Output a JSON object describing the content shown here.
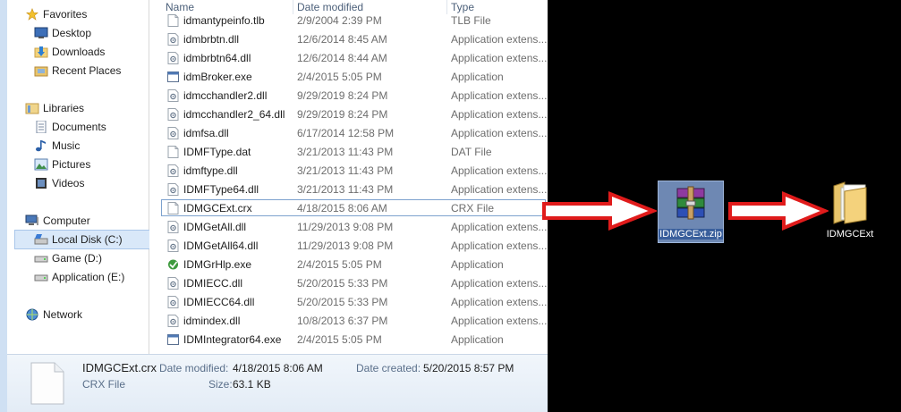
{
  "nav": {
    "favorites": "Favorites",
    "desktop": "Desktop",
    "downloads": "Downloads",
    "recent_places": "Recent Places",
    "libraries": "Libraries",
    "documents": "Documents",
    "music": "Music",
    "pictures": "Pictures",
    "videos": "Videos",
    "computer": "Computer",
    "local_disk": "Local Disk (C:)",
    "game": "Game (D:)",
    "application": "Application (E:)",
    "network": "Network"
  },
  "columns": {
    "name": "Name",
    "date": "Date modified",
    "type": "Type"
  },
  "files": [
    {
      "name": "idmantypeinfo.tlb",
      "date": "2/9/2004 2:39 PM",
      "type": "TLB File",
      "icon": "file-icon"
    },
    {
      "name": "idmbrbtn.dll",
      "date": "12/6/2014 8:45 AM",
      "type": "Application extens...",
      "icon": "dll-icon"
    },
    {
      "name": "idmbrbtn64.dll",
      "date": "12/6/2014 8:44 AM",
      "type": "Application extens...",
      "icon": "dll-icon"
    },
    {
      "name": "idmBroker.exe",
      "date": "2/4/2015 5:05 PM",
      "type": "Application",
      "icon": "exe-icon"
    },
    {
      "name": "idmcchandler2.dll",
      "date": "9/29/2019 8:24 PM",
      "type": "Application extens...",
      "icon": "dll-icon"
    },
    {
      "name": "idmcchandler2_64.dll",
      "date": "9/29/2019 8:24 PM",
      "type": "Application extens...",
      "icon": "dll-icon"
    },
    {
      "name": "idmfsa.dll",
      "date": "6/17/2014 12:58 PM",
      "type": "Application extens...",
      "icon": "dll-icon"
    },
    {
      "name": "IDMFType.dat",
      "date": "3/21/2013 11:43 PM",
      "type": "DAT File",
      "icon": "file-icon"
    },
    {
      "name": "idmftype.dll",
      "date": "3/21/2013 11:43 PM",
      "type": "Application extens...",
      "icon": "dll-icon"
    },
    {
      "name": "IDMFType64.dll",
      "date": "3/21/2013 11:43 PM",
      "type": "Application extens...",
      "icon": "dll-icon"
    },
    {
      "name": "IDMGCExt.crx",
      "date": "4/18/2015 8:06 AM",
      "type": "CRX File",
      "icon": "file-icon",
      "selected": true
    },
    {
      "name": "IDMGetAll.dll",
      "date": "11/29/2013 9:08 PM",
      "type": "Application extens...",
      "icon": "dll-icon"
    },
    {
      "name": "IDMGetAll64.dll",
      "date": "11/29/2013 9:08 PM",
      "type": "Application extens...",
      "icon": "dll-icon"
    },
    {
      "name": "IDMGrHlp.exe",
      "date": "2/4/2015 5:05 PM",
      "type": "Application",
      "icon": "idm-exe-icon"
    },
    {
      "name": "IDMIECC.dll",
      "date": "5/20/2015 5:33 PM",
      "type": "Application extens...",
      "icon": "dll-icon"
    },
    {
      "name": "IDMIECC64.dll",
      "date": "5/20/2015 5:33 PM",
      "type": "Application extens...",
      "icon": "dll-icon"
    },
    {
      "name": "idmindex.dll",
      "date": "10/8/2013 6:37 PM",
      "type": "Application extens...",
      "icon": "dll-icon"
    },
    {
      "name": "IDMIntegrator64.exe",
      "date": "2/4/2015 5:05 PM",
      "type": "Application",
      "icon": "exe-icon"
    }
  ],
  "details": {
    "filename": "IDMGCExt.crx",
    "filetype": "CRX File",
    "modified_label": "Date modified:",
    "modified_value": "4/18/2015 8:06 AM",
    "created_label": "Date created:",
    "created_value": "5/20/2015 8:57 PM",
    "size_label": "Size:",
    "size_value": "63.1 KB"
  },
  "desktop": {
    "zip_label": "IDMGCExt.zip",
    "folder_label": "IDMGCExt"
  },
  "colors": {
    "arrow_fill": "#ffffff",
    "arrow_stroke": "#e01b1b",
    "selection": "#d9e8f9"
  }
}
